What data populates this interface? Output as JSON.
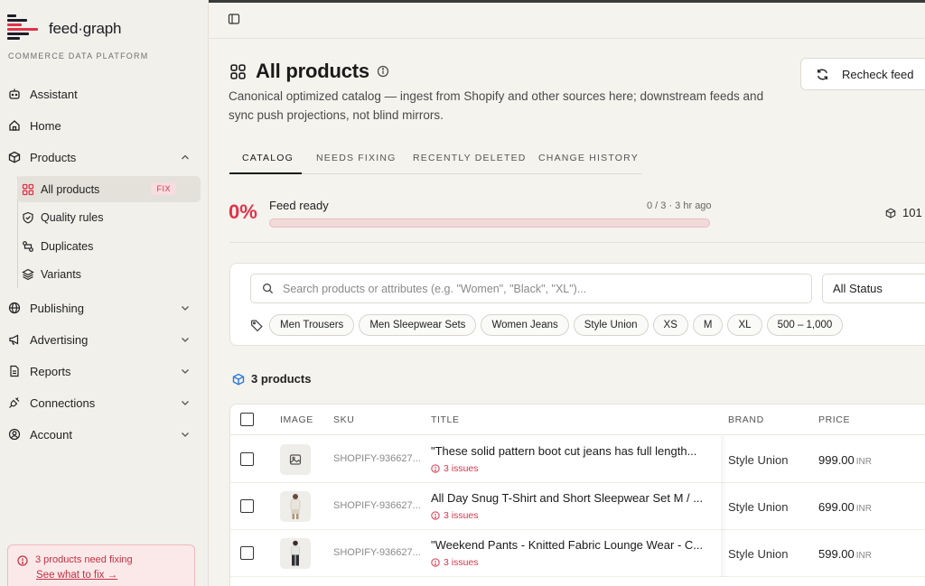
{
  "brand": {
    "name": "feed·graph",
    "tagline": "COMMERCE DATA PLATFORM"
  },
  "sidebar": {
    "items": [
      {
        "label": "Assistant",
        "icon": "robot-icon"
      },
      {
        "label": "Home",
        "icon": "home-icon"
      },
      {
        "label": "Products",
        "icon": "box-icon",
        "expanded": true
      },
      {
        "label": "Publishing",
        "icon": "globe-icon"
      },
      {
        "label": "Advertising",
        "icon": "megaphone-icon"
      },
      {
        "label": "Reports",
        "icon": "report-icon"
      },
      {
        "label": "Connections",
        "icon": "plug-icon"
      },
      {
        "label": "Account",
        "icon": "user-circle-icon"
      }
    ],
    "sub_items": [
      {
        "label": "All products",
        "icon": "grid-icon",
        "active": true,
        "badge": "FIX"
      },
      {
        "label": "Quality rules",
        "icon": "shield-icon"
      },
      {
        "label": "Duplicates",
        "icon": "duplicate-icon"
      },
      {
        "label": "Variants",
        "icon": "layers-icon"
      }
    ],
    "alert": {
      "text": "3 products need fixing",
      "link": "See what to fix →"
    }
  },
  "page": {
    "title": "All products",
    "description": "Canonical optimized catalog — ingest from Shopify and other sources here; downstream feeds and sync push projections, not blind mirrors.",
    "recheck_label": "Recheck feed"
  },
  "tabs": [
    {
      "label": "CATALOG",
      "active": true
    },
    {
      "label": "NEEDS FIXING"
    },
    {
      "label": "RECENTLY DELETED"
    },
    {
      "label": "CHANGE HISTORY"
    }
  ],
  "feed": {
    "percent": "0%",
    "progress": 0,
    "label": "Feed ready",
    "meta": "0 / 3 · 3 hr ago",
    "count": "101"
  },
  "filters": {
    "search_placeholder": "Search products or attributes (e.g. \"Women\", \"Black\", \"XL\")...",
    "status": "All Status",
    "chips": [
      "Men Trousers",
      "Men Sleepwear Sets",
      "Women Jeans",
      "Style Union",
      "XS",
      "M",
      "XL",
      "500 – 1,000"
    ]
  },
  "products": {
    "count_label": "3 products",
    "columns": {
      "image": "IMAGE",
      "sku": "SKU",
      "title": "TITLE",
      "brand": "BRAND",
      "price": "PRICE"
    },
    "rows": [
      {
        "sku": "SHOPIFY-936627...",
        "title": "\"These solid pattern boot cut jeans has full length...",
        "issues": "3 issues",
        "brand": "Style Union",
        "price": "999.00",
        "currency": "INR",
        "image": "image-placeholder-icon"
      },
      {
        "sku": "SHOPIFY-936627...",
        "title": "All Day Snug T-Shirt and Short Sleepwear Set M / ...",
        "issues": "3 issues",
        "brand": "Style Union",
        "price": "699.00",
        "currency": "INR",
        "image": "model-photo"
      },
      {
        "sku": "SHOPIFY-936627...",
        "title": "\"Weekend Pants - Knitted Fabric Lounge Wear - C...",
        "issues": "3 issues",
        "brand": "Style Union",
        "price": "599.00",
        "currency": "INR",
        "image": "model-photo"
      }
    ]
  },
  "colors": {
    "accent": "#e0344b",
    "text": "#1a1a1a",
    "background": "#f4f3ee"
  }
}
